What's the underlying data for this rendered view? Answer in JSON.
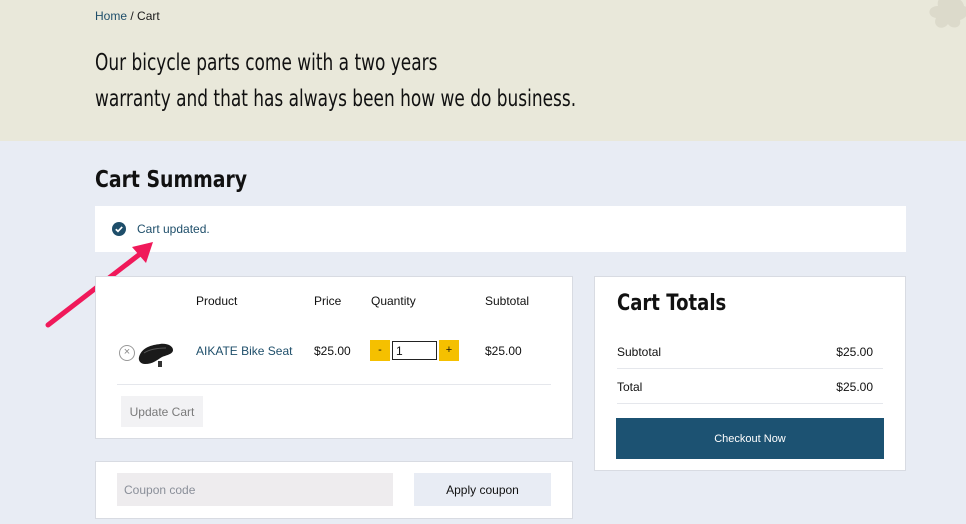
{
  "breadcrumb": {
    "home": "Home",
    "separator": "/",
    "current": "Cart"
  },
  "hero": {
    "line1": "Our bicycle parts come with a two years",
    "line2": "warranty and that has always been how we do business."
  },
  "page_title": "Cart Summary",
  "notice": {
    "message": "Cart updated.",
    "icon": "check-circle-icon"
  },
  "cart": {
    "headers": {
      "product": "Product",
      "price": "Price",
      "quantity": "Quantity",
      "subtotal": "Subtotal"
    },
    "items": [
      {
        "name": "AIKATE Bike Seat",
        "price": "$25.00",
        "quantity": "1",
        "subtotal": "$25.00"
      }
    ],
    "qty_minus": "-",
    "qty_plus": "+",
    "remove_symbol": "×",
    "update_label": "Update Cart"
  },
  "coupon": {
    "placeholder": "Coupon code",
    "apply_label": "Apply coupon"
  },
  "totals": {
    "title": "Cart Totals",
    "subtotal_label": "Subtotal",
    "subtotal_value": "$25.00",
    "total_label": "Total",
    "total_value": "$25.00",
    "checkout_label": "Checkout Now"
  },
  "colors": {
    "accent": "#1c5272",
    "qty_button": "#f5c000",
    "annotation_arrow": "#f0195a"
  }
}
